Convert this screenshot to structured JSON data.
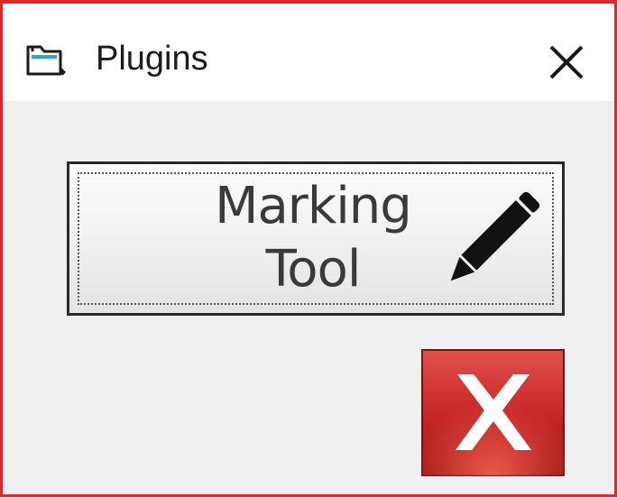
{
  "window": {
    "title": "Plugins",
    "icon": "folder-plugin-icon",
    "close_icon": "close-icon",
    "border_color": "#e0282c"
  },
  "main": {
    "marking_tool_button": {
      "label_line1": "Marking",
      "label_line2": "Tool",
      "icon": "pencil-icon"
    },
    "cancel_button": {
      "icon": "red-x-icon",
      "color": "#c62828"
    }
  }
}
